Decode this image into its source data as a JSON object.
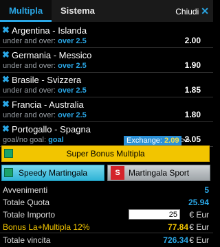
{
  "tabs": {
    "multipla": "Multipla",
    "sistema": "Sistema"
  },
  "close": {
    "label": "Chiudi",
    "icon": "close-icon"
  },
  "bets": [
    {
      "event": "Argentina - Islanda",
      "market": "under and over:",
      "selection": "over 2.5",
      "odd": "2.00"
    },
    {
      "event": "Germania - Messico",
      "market": "under and over:",
      "selection": "over 2.5",
      "odd": "1.90"
    },
    {
      "event": "Brasile - Svizzera",
      "market": "under and over:",
      "selection": "over 2.5",
      "odd": "1.85"
    },
    {
      "event": "Francia - Australia",
      "market": "under and over:",
      "selection": "over 2.5",
      "odd": "1.80"
    },
    {
      "event": "Portogallo - Spagna",
      "market": "goal/no goal:",
      "selection": "goal",
      "odd": "2.05",
      "exchange": {
        "label": "Exchange:",
        "value": "2.09",
        "arrow": ">>"
      }
    }
  ],
  "buttons": {
    "super_bonus": "Super Bonus Multipla",
    "speedy": "Speedy Martingala",
    "martingala": "Martingala Sport",
    "martingala_badge": "S"
  },
  "summary": {
    "avvenimenti_label": "Avvenimenti",
    "avvenimenti_value": "5",
    "quota_label": "Totale Quota",
    "quota_value": "25.94",
    "importo_label": "Totale Importo",
    "importo_value": "25",
    "importo_currency": "€ Eur",
    "bonus_label": "Bonus La+Multipla 12%",
    "bonus_value": "77.84",
    "bonus_currency": "€ Eur",
    "vincita_label": "Totale vincita",
    "vincita_value": "726.34",
    "vincita_currency": "€ Eur"
  },
  "colors": {
    "accent": "#2aa7e6",
    "bonus": "#f2c500",
    "exchange": "#2a8fd6"
  }
}
